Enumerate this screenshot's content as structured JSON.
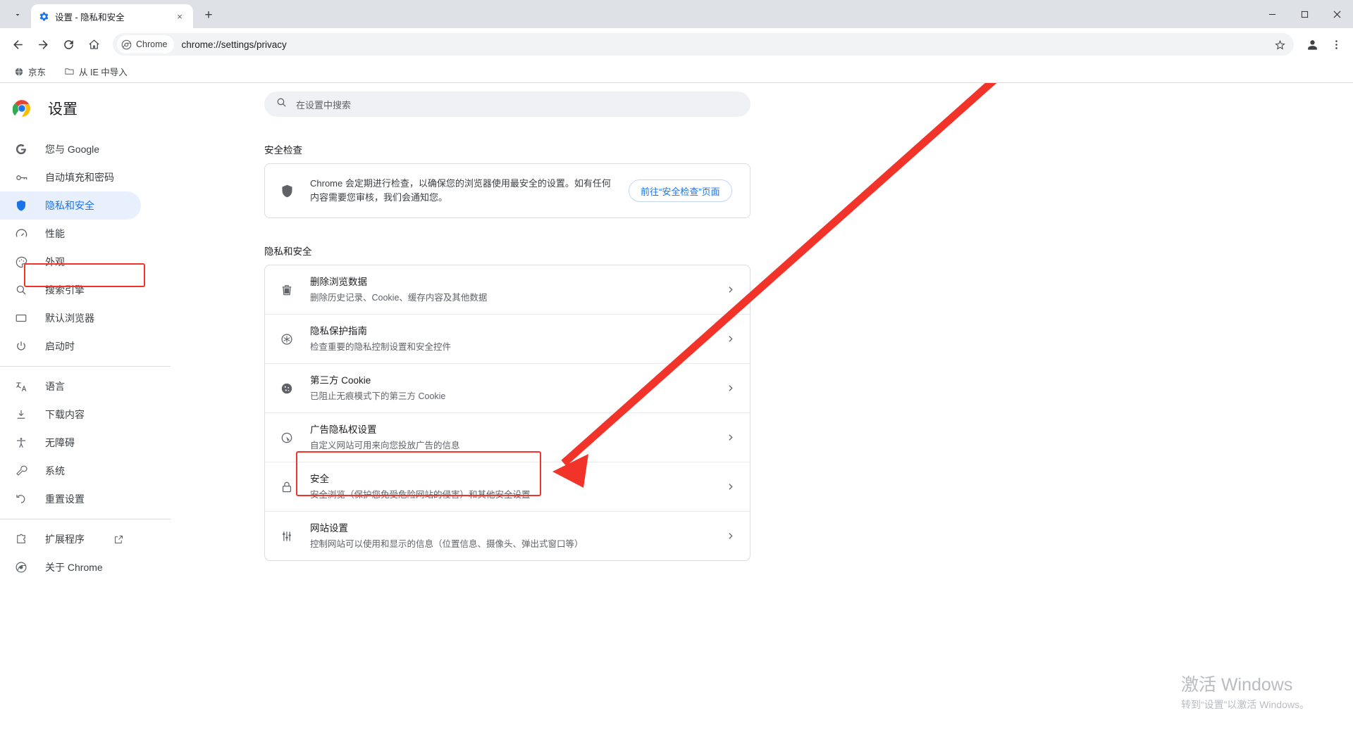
{
  "window": {
    "tab": {
      "title": "设置 - 隐私和安全",
      "favicon": "settings-gear-icon",
      "close": "×"
    },
    "new_tab_label": "+",
    "tab_search_icon": "chevron-down-icon",
    "controls": {
      "minimize": "—",
      "maximize": "▢",
      "close": "✕"
    }
  },
  "toolbar": {
    "back": "←",
    "forward": "→",
    "reload": "⟳",
    "home": "⌂",
    "chip_label": "Chrome",
    "url": "chrome://settings/privacy",
    "bookmark_star": "☆",
    "profile": "profile-avatar",
    "menu": "⋮"
  },
  "bookmarks": [
    {
      "label": "京东",
      "icon": "globe-icon"
    },
    {
      "label": "从 IE 中导入",
      "icon": "folder-icon"
    }
  ],
  "sidebar": {
    "brand": "设置",
    "items": [
      {
        "label": "您与 Google",
        "icon": "google-g-icon",
        "active": false
      },
      {
        "label": "自动填充和密码",
        "icon": "key-icon",
        "active": false
      },
      {
        "label": "隐私和安全",
        "icon": "shield-icon",
        "active": true
      },
      {
        "label": "性能",
        "icon": "speedometer-icon",
        "active": false
      },
      {
        "label": "外观",
        "icon": "palette-icon",
        "active": false
      },
      {
        "label": "搜索引擎",
        "icon": "search-icon",
        "active": false
      },
      {
        "label": "默认浏览器",
        "icon": "window-icon",
        "active": false
      },
      {
        "label": "启动时",
        "icon": "power-icon",
        "active": false
      }
    ],
    "items2": [
      {
        "label": "语言",
        "icon": "translate-icon",
        "active": false
      },
      {
        "label": "下载内容",
        "icon": "download-icon",
        "active": false
      },
      {
        "label": "无障碍",
        "icon": "accessibility-icon",
        "active": false
      },
      {
        "label": "系统",
        "icon": "wrench-icon",
        "active": false
      },
      {
        "label": "重置设置",
        "icon": "restore-icon",
        "active": false
      }
    ],
    "items3": [
      {
        "label": "扩展程序",
        "icon": "extension-icon",
        "external": true
      },
      {
        "label": "关于 Chrome",
        "icon": "chrome-icon",
        "external": false
      }
    ]
  },
  "search": {
    "placeholder": "在设置中搜索",
    "icon": "search-icon"
  },
  "safety_check": {
    "heading": "安全检查",
    "icon": "shield-icon",
    "description": "Chrome 会定期进行检查，以确保您的浏览器使用最安全的设置。如有任何内容需要您审核，我们会通知您。",
    "button_label": "前往“安全检查”页面"
  },
  "privacy": {
    "heading": "隐私和安全",
    "rows": [
      {
        "icon": "trash-icon",
        "title": "删除浏览数据",
        "subtitle": "删除历史记录、Cookie、缓存内容及其他数据",
        "chevron": "›"
      },
      {
        "icon": "privacy-guide-icon",
        "title": "隐私保护指南",
        "subtitle": "检查重要的隐私控制设置和安全控件",
        "chevron": "›"
      },
      {
        "icon": "cookie-icon",
        "title": "第三方 Cookie",
        "subtitle": "已阻止无痕模式下的第三方 Cookie",
        "chevron": "›"
      },
      {
        "icon": "ad-privacy-icon",
        "title": "广告隐私权设置",
        "subtitle": "自定义网站可用来向您投放广告的信息",
        "chevron": "›"
      },
      {
        "icon": "lock-icon",
        "title": "安全",
        "subtitle": "安全浏览（保护您免受危险网站的侵害）和其他安全设置",
        "chevron": "›"
      },
      {
        "icon": "sliders-icon",
        "title": "网站设置",
        "subtitle": "控制网站可以使用和显示的信息（位置信息、摄像头、弹出式窗口等）",
        "chevron": "›"
      }
    ]
  },
  "annotations": {
    "highlight_color": "#f1332a",
    "arrow_color": "#f1332a",
    "targets": [
      "隐私和安全",
      "安全"
    ]
  },
  "watermark": {
    "line1": "激活 Windows",
    "line2": "转到“设置”以激活 Windows。"
  }
}
